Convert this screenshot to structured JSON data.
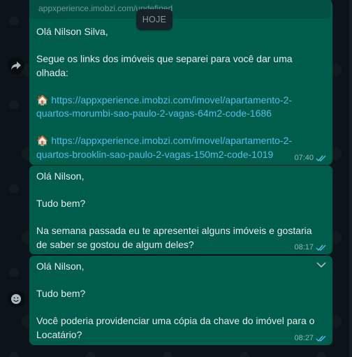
{
  "date_chip": "HOJE",
  "quote_text": "appxperience.imobzi.com/undefined",
  "messages": [
    {
      "greeting": "Olá Nilson Silva,",
      "intro": "Segue os links dos imóveis que separei para você dar uma olhada:",
      "link1_emoji": "🏠",
      "link1": "https://appxperience.imobzi.com/imovel/apartamento-2-quartos-morumbi-sao-paulo-2-vagas-64m2-code-1686",
      "link2_emoji": "🏠",
      "link2": "https://appxperience.imobzi.com/imovel/apartamento-2-quartos-brooklin-sao-paulo-2-vagas-150m2-code-1019",
      "time": "07:40"
    },
    {
      "line1": "Olá Nilson,",
      "line2": "Tudo bem?",
      "line3": "Na semana passada eu te apresentei alguns imóveis e gostaria de saber se gostou de algum deles?",
      "time": "08:17"
    },
    {
      "line1": "Olá Nilson,",
      "line2": "Tudo bem?",
      "line3": "Você poderia providenciar uma cópia da chave do imóvel para o Locatário?",
      "time": "08:27"
    }
  ],
  "icons": {
    "forward": "forward-icon",
    "emoji": "emoji-icon",
    "read_receipt": "double-check-icon",
    "menu": "chevron-down-icon"
  },
  "colors": {
    "outgoing_bubble": "#005c4b",
    "link": "#53bdeb",
    "read_ticks": "#53bdeb",
    "background": "#0b141a"
  }
}
